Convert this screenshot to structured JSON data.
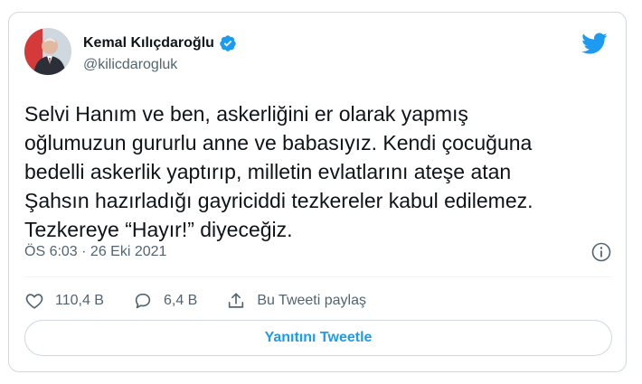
{
  "author": {
    "name": "Kemal Kılıçdaroğlu",
    "handle": "@kilicdarogluk",
    "verified_icon": "verified-badge-icon"
  },
  "tweet": {
    "text": "Selvi Hanım ve ben, askerliğini er olarak yapmış\noğlumuzun gururlu anne ve babasıyız. Kendi çocuğuna\nbedelli askerlik yaptırıp, milletin evlatlarını ateşe atan\nŞahsın hazırladığı gayriciddi tezkereler kabul edilemez.\nTezkereye “Hayır!” diyeceğiz.",
    "timestamp": "ÖS 6:03 · 26 Eki 2021"
  },
  "actions": {
    "likes": "110,4 B",
    "replies": "6,4 B",
    "share_label": "Bu Tweeti paylaş"
  },
  "reply_button_label": "Yanıtını Tweetle",
  "colors": {
    "brand": "#1d9bf0",
    "text": "#0f1419",
    "secondary": "#536471",
    "border": "#cfd9de"
  }
}
